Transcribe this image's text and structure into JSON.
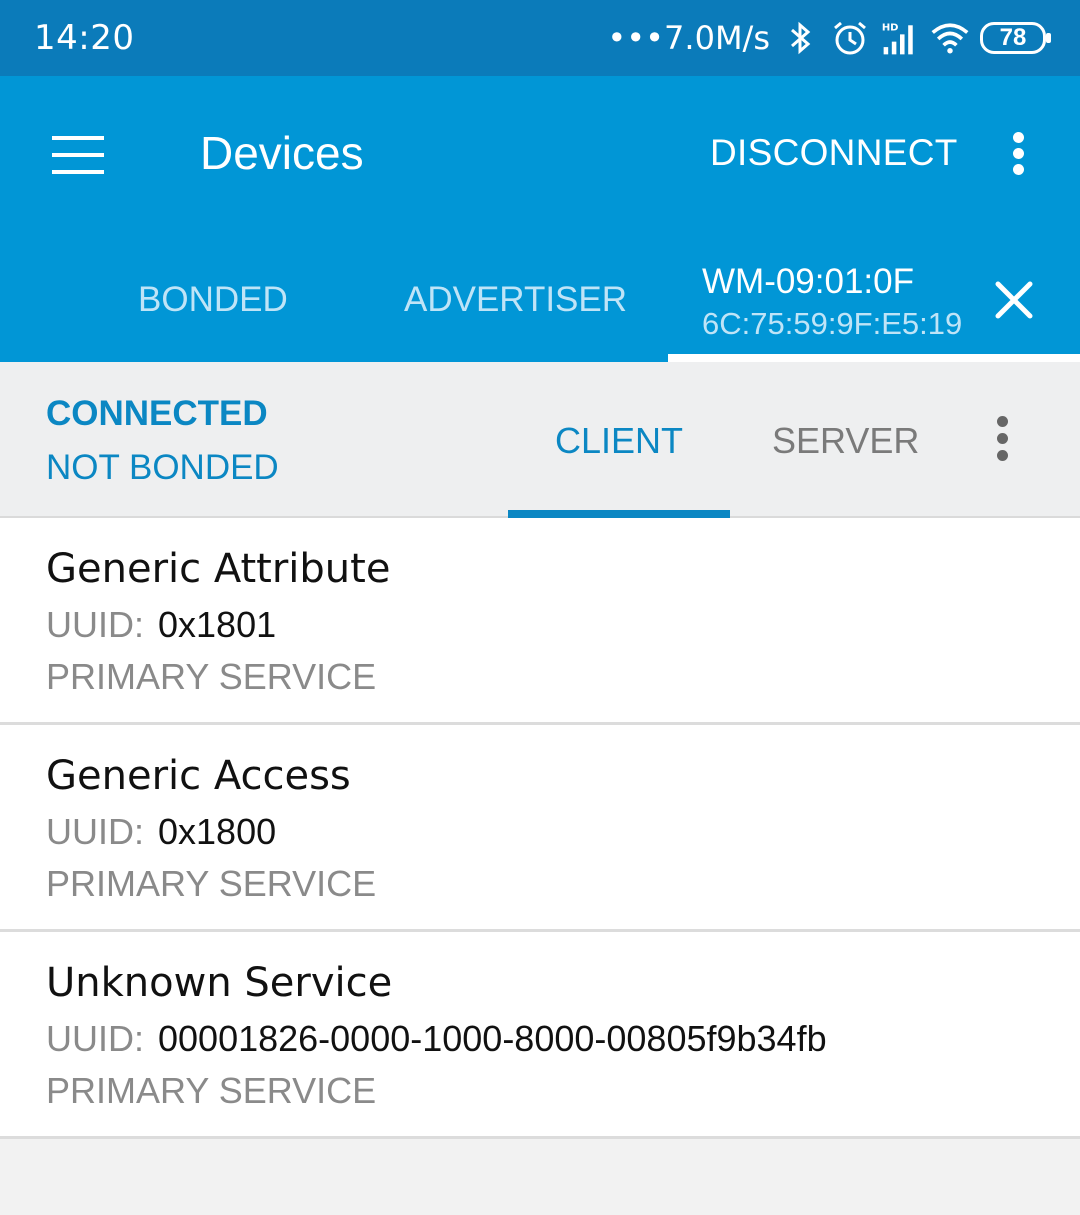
{
  "status_bar": {
    "time": "14:20",
    "net_speed": "•••7.0M/s",
    "icons": [
      "bluetooth-icon",
      "alarm-icon",
      "hd-signal-icon",
      "wifi-icon"
    ],
    "battery": "78"
  },
  "app_bar": {
    "title": "Devices",
    "disconnect_label": "DISCONNECT"
  },
  "tabs": {
    "bonded": "BONDED",
    "advertiser": "ADVERTISER",
    "device_name": "WM-09:01:0F",
    "device_mac": "6C:75:59:9F:E5:19"
  },
  "connection": {
    "state": "CONNECTED",
    "bond": "NOT BONDED",
    "client_tab": "CLIENT",
    "server_tab": "SERVER"
  },
  "services": [
    {
      "name": "Generic Attribute",
      "uuid_label": "UUID:",
      "uuid": "0x1801",
      "type": "PRIMARY SERVICE"
    },
    {
      "name": "Generic Access",
      "uuid_label": "UUID:",
      "uuid": "0x1800",
      "type": "PRIMARY SERVICE"
    },
    {
      "name": "Unknown Service",
      "uuid_label": "UUID:",
      "uuid": "00001826-0000-1000-8000-00805f9b34fb",
      "type": "PRIMARY SERVICE"
    }
  ],
  "colors": {
    "status_bar": "#0b7bba",
    "app_bar": "#0196d6",
    "accent": "#0b87c3"
  }
}
